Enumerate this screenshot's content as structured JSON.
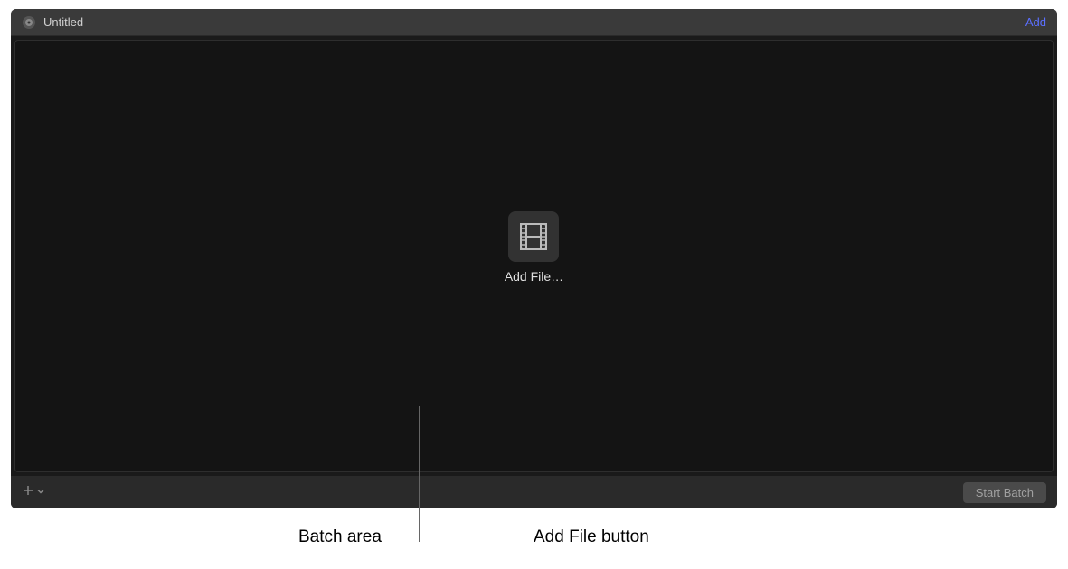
{
  "header": {
    "title": "Untitled",
    "add_label": "Add"
  },
  "batch": {
    "add_file_label": "Add File…"
  },
  "footer": {
    "start_batch_label": "Start Batch"
  },
  "annotations": {
    "batch_area": "Batch area",
    "add_file_button": "Add File button"
  },
  "icons": {
    "app": "compressor-app-icon",
    "film": "film-strip-icon",
    "plus": "plus-icon",
    "chevron_down": "chevron-down-icon"
  }
}
